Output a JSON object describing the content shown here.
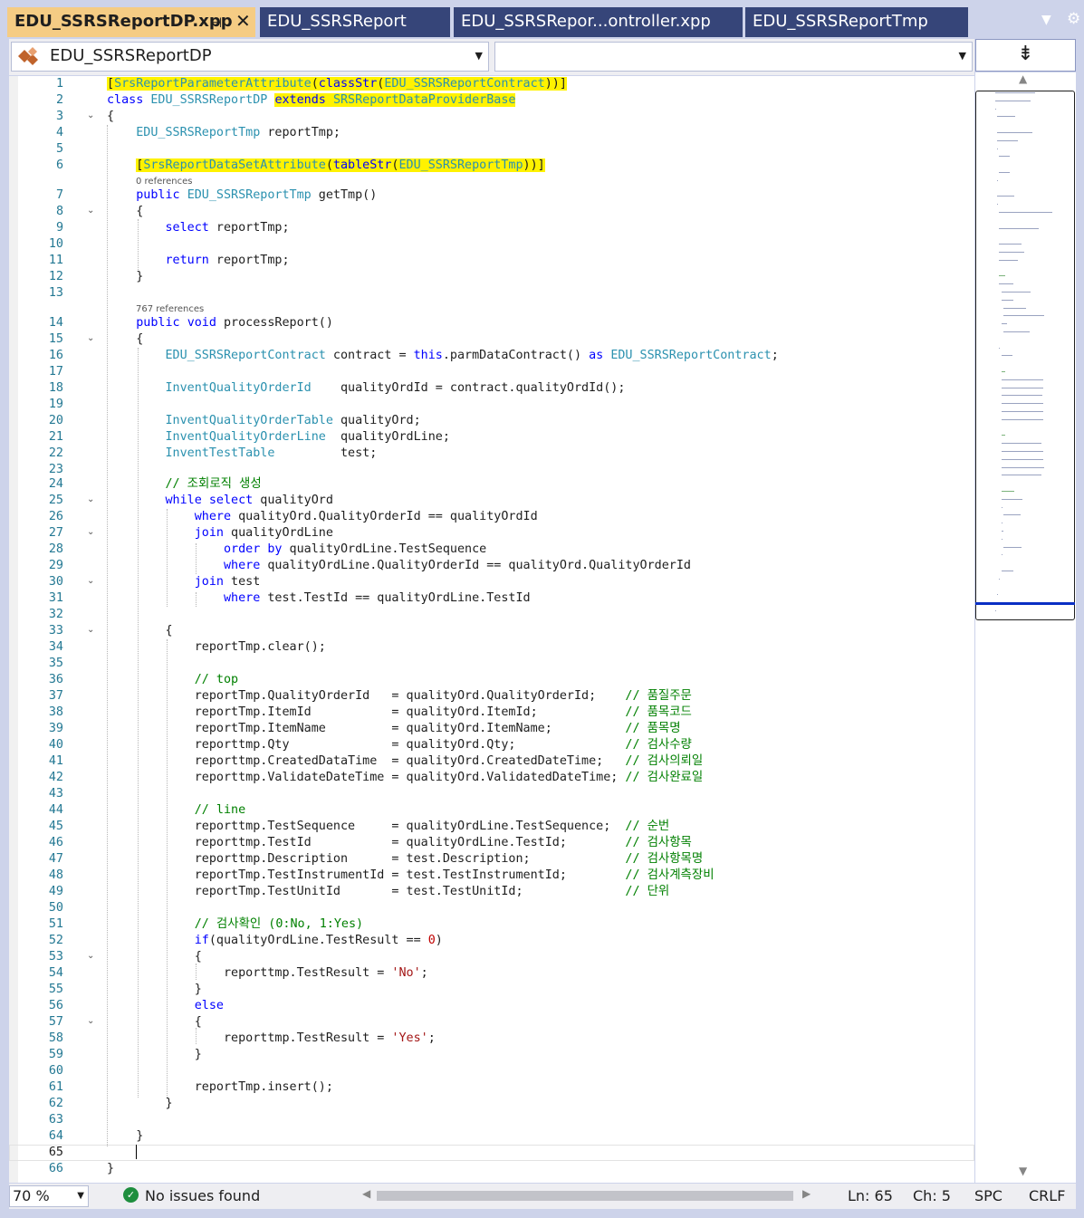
{
  "tabs": [
    {
      "label": "EDU_SSRSReportDP.xpp",
      "active": true
    },
    {
      "label": "EDU_SSRSReport",
      "active": false
    },
    {
      "label": "EDU_SSRSRepor...ontroller.xpp",
      "active": false
    },
    {
      "label": "EDU_SSRSReportTmp",
      "active": false
    }
  ],
  "tab_icons": {
    "pin": "pin-icon",
    "close": "close-icon",
    "dropdown": "chevron-down-icon",
    "settings": "gear-icon"
  },
  "navigation": {
    "type_combo": "EDU_SSRSReportDP",
    "member_combo": ""
  },
  "codelens": {
    "getTmp": "0 references",
    "processReport": "767 references"
  },
  "code_lines": [
    {
      "n": "1",
      "t": "[SrsReportParameterAttribute(classStr(EDU_SSRSReportContract))]"
    },
    {
      "n": "2",
      "t": "class EDU_SSRSReportDP extends SRSReportDataProviderBase"
    },
    {
      "n": "3",
      "t": "{"
    },
    {
      "n": "4",
      "t": "    EDU_SSRSReportTmp reportTmp;"
    },
    {
      "n": "5",
      "t": ""
    },
    {
      "n": "6",
      "t": "    [SrsReportDataSetAttribute(tableStr(EDU_SSRSReportTmp))]"
    },
    {
      "n": "7",
      "t": "    public EDU_SSRSReportTmp getTmp()"
    },
    {
      "n": "8",
      "t": "    {"
    },
    {
      "n": "9",
      "t": "        select reportTmp;"
    },
    {
      "n": "10",
      "t": ""
    },
    {
      "n": "11",
      "t": "        return reportTmp;"
    },
    {
      "n": "12",
      "t": "    }"
    },
    {
      "n": "13",
      "t": ""
    },
    {
      "n": "14",
      "t": "    public void processReport()"
    },
    {
      "n": "15",
      "t": "    {"
    },
    {
      "n": "16",
      "t": "        EDU_SSRSReportContract contract = this.parmDataContract() as EDU_SSRSReportContract;"
    },
    {
      "n": "17",
      "t": ""
    },
    {
      "n": "18",
      "t": "        InventQualityOrderId    qualityOrdId = contract.qualityOrdId();"
    },
    {
      "n": "19",
      "t": ""
    },
    {
      "n": "20",
      "t": "        InventQualityOrderTable qualityOrd;"
    },
    {
      "n": "21",
      "t": "        InventQualityOrderLine  qualityOrdLine;"
    },
    {
      "n": "22",
      "t": "        InventTestTable         test;"
    },
    {
      "n": "23",
      "t": ""
    },
    {
      "n": "24",
      "t": "        // 조회로직 생성"
    },
    {
      "n": "25",
      "t": "        while select qualityOrd"
    },
    {
      "n": "26",
      "t": "            where qualityOrd.QualityOrderId == qualityOrdId"
    },
    {
      "n": "27",
      "t": "            join qualityOrdLine"
    },
    {
      "n": "28",
      "t": "                order by qualityOrdLine.TestSequence"
    },
    {
      "n": "29",
      "t": "                where qualityOrdLine.QualityOrderId == qualityOrd.QualityOrderId"
    },
    {
      "n": "30",
      "t": "            join test"
    },
    {
      "n": "31",
      "t": "                where test.TestId == qualityOrdLine.TestId"
    },
    {
      "n": "32",
      "t": ""
    },
    {
      "n": "33",
      "t": "        {"
    },
    {
      "n": "34",
      "t": "            reportTmp.clear();"
    },
    {
      "n": "35",
      "t": ""
    },
    {
      "n": "36",
      "t": "            // top"
    },
    {
      "n": "37",
      "t": "            reportTmp.QualityOrderId   = qualityOrd.QualityOrderId;    // 품질주문"
    },
    {
      "n": "38",
      "t": "            reportTmp.ItemId           = qualityOrd.ItemId;            // 품목코드"
    },
    {
      "n": "39",
      "t": "            reportTmp.ItemName         = qualityOrd.ItemName;          // 품목명"
    },
    {
      "n": "40",
      "t": "            reporttmp.Qty              = qualityOrd.Qty;               // 검사수량"
    },
    {
      "n": "41",
      "t": "            reporttmp.CreatedDataTime  = qualityOrd.CreatedDateTime;   // 검사의뢰일"
    },
    {
      "n": "42",
      "t": "            reporttmp.ValidateDateTime = qualityOrd.ValidatedDateTime; // 검사완료일"
    },
    {
      "n": "43",
      "t": ""
    },
    {
      "n": "44",
      "t": "            // line"
    },
    {
      "n": "45",
      "t": "            reporttmp.TestSequence     = qualityOrdLine.TestSequence;  // 순번"
    },
    {
      "n": "46",
      "t": "            reporttmp.TestId           = qualityOrdLine.TestId;        // 검사항목"
    },
    {
      "n": "47",
      "t": "            reporttmp.Description      = test.Description;             // 검사항목명"
    },
    {
      "n": "48",
      "t": "            reportTmp.TestInstrumentId = test.TestInstrumentId;        // 검사계측장비"
    },
    {
      "n": "49",
      "t": "            reportTmp.TestUnitId       = test.TestUnitId;              // 단위"
    },
    {
      "n": "50",
      "t": ""
    },
    {
      "n": "51",
      "t": "            // 검사확인 (0:No, 1:Yes)"
    },
    {
      "n": "52",
      "t": "            if(qualityOrdLine.TestResult == 0)"
    },
    {
      "n": "53",
      "t": "            {"
    },
    {
      "n": "54",
      "t": "                reporttmp.TestResult = 'No';"
    },
    {
      "n": "55",
      "t": "            }"
    },
    {
      "n": "56",
      "t": "            else"
    },
    {
      "n": "57",
      "t": "            {"
    },
    {
      "n": "58",
      "t": "                reporttmp.TestResult = 'Yes';"
    },
    {
      "n": "59",
      "t": "            }"
    },
    {
      "n": "60",
      "t": ""
    },
    {
      "n": "61",
      "t": "            reportTmp.insert();"
    },
    {
      "n": "62",
      "t": "        }"
    },
    {
      "n": "63",
      "t": ""
    },
    {
      "n": "64",
      "t": "    }"
    },
    {
      "n": "65",
      "t": ""
    },
    {
      "n": "66",
      "t": "}"
    }
  ],
  "status": {
    "zoom": "70 %",
    "issues": "No issues found",
    "line": "Ln: 65",
    "char": "Ch: 5",
    "whitespace": "SPC",
    "line_ending": "CRLF"
  },
  "colors": {
    "keyword": "#0000ff",
    "type": "#2b91af",
    "comment": "#008000",
    "string": "#a31515",
    "number": "#c00000",
    "highlight": "#fff200",
    "active_tab": "#f5cc84",
    "tab_background": "#364579"
  }
}
